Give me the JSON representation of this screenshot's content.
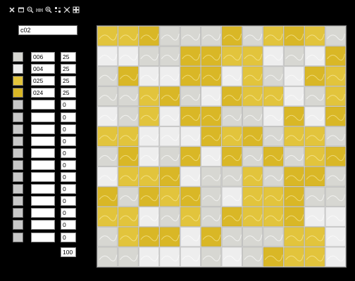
{
  "toolbar": {
    "tools": [
      {
        "name": "close-icon"
      },
      {
        "name": "window-icon"
      },
      {
        "name": "zoom-out-icon"
      },
      {
        "name": "actual-size-icon"
      },
      {
        "name": "zoom-in-icon"
      },
      {
        "name": "shuffle-icon"
      },
      {
        "name": "fit-icon"
      },
      {
        "name": "grid-icon"
      }
    ]
  },
  "mix_name": "c02",
  "tiles": [
    {
      "code": "006",
      "percent": "25",
      "color": "#d7d7d2"
    },
    {
      "code": "004",
      "percent": "25",
      "color": "#eeeeee"
    },
    {
      "code": "025",
      "percent": "25",
      "color": "#e2c43c"
    },
    {
      "code": "024",
      "percent": "25",
      "color": "#d9b726"
    },
    {
      "code": "",
      "percent": "0",
      "color": "#c8c8c8"
    },
    {
      "code": "",
      "percent": "0",
      "color": "#c8c8c8"
    },
    {
      "code": "",
      "percent": "0",
      "color": "#c8c8c8"
    },
    {
      "code": "",
      "percent": "0",
      "color": "#c8c8c8"
    },
    {
      "code": "",
      "percent": "0",
      "color": "#c8c8c8"
    },
    {
      "code": "",
      "percent": "0",
      "color": "#c8c8c8"
    },
    {
      "code": "",
      "percent": "0",
      "color": "#c8c8c8"
    },
    {
      "code": "",
      "percent": "0",
      "color": "#c8c8c8"
    },
    {
      "code": "",
      "percent": "0",
      "color": "#c8c8c8"
    },
    {
      "code": "",
      "percent": "0",
      "color": "#c8c8c8"
    },
    {
      "code": "",
      "percent": "0",
      "color": "#c8c8c8"
    },
    {
      "code": "",
      "percent": "0",
      "color": "#c8c8c8"
    }
  ],
  "total_percent": "100",
  "mosaic": {
    "columns": 12,
    "rows": 12,
    "grout_color": "#cfcfcf",
    "pattern": [
      "223000302320",
      "110033221013",
      "031133120132",
      "002301322102",
      "102133001313",
      "221113230220",
      "031031303023",
      "122310020330",
      "303230122300",
      "221020322311",
      "023313000221",
      "001110103221",
      "330031123302",
      "002033202013",
      "121302112303"
    ]
  }
}
